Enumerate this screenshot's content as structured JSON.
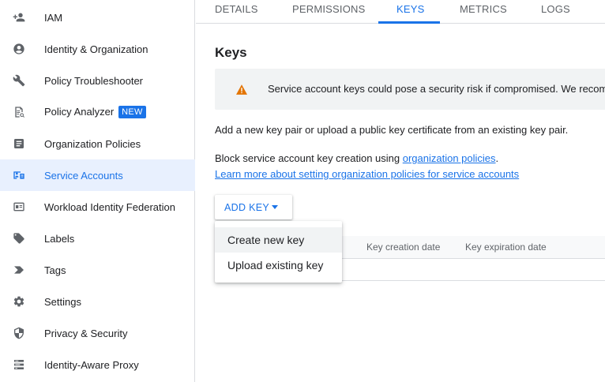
{
  "sidebar": {
    "items": [
      {
        "label": "IAM",
        "icon": "person-add-icon"
      },
      {
        "label": "Identity & Organization",
        "icon": "account-circle-icon"
      },
      {
        "label": "Policy Troubleshooter",
        "icon": "wrench-icon"
      },
      {
        "label": "Policy Analyzer",
        "icon": "policy-analyzer-icon",
        "badge": "NEW"
      },
      {
        "label": "Organization Policies",
        "icon": "article-icon"
      },
      {
        "label": "Service Accounts",
        "icon": "service-account-icon",
        "active": true
      },
      {
        "label": "Workload Identity Federation",
        "icon": "id-card-icon"
      },
      {
        "label": "Labels",
        "icon": "label-icon"
      },
      {
        "label": "Tags",
        "icon": "tag-chevron-icon"
      },
      {
        "label": "Settings",
        "icon": "gear-icon"
      },
      {
        "label": "Privacy & Security",
        "icon": "shield-icon"
      },
      {
        "label": "Identity-Aware Proxy",
        "icon": "proxy-icon"
      }
    ]
  },
  "tabs": [
    "DETAILS",
    "PERMISSIONS",
    "KEYS",
    "METRICS",
    "LOGS"
  ],
  "active_tab": "KEYS",
  "main": {
    "title": "Keys",
    "alert": "Service account keys could pose a security risk if compromised. We recom",
    "intro": "Add a new key pair or upload a public key certificate from an existing key pair.",
    "block_prefix": "Block service account key creation using ",
    "block_link": "organization policies",
    "block_suffix": ".",
    "learn_link": "Learn more about setting organization policies for service accounts",
    "add_key": "ADD KEY"
  },
  "table": {
    "headers": [
      "Key creation date",
      "Key expiration date"
    ]
  },
  "menu": {
    "items": [
      "Create new key",
      "Upload existing key"
    ]
  },
  "colors": {
    "accent": "#1a73e8",
    "warning": "#e37400",
    "active_bg": "#e8f0fe"
  }
}
